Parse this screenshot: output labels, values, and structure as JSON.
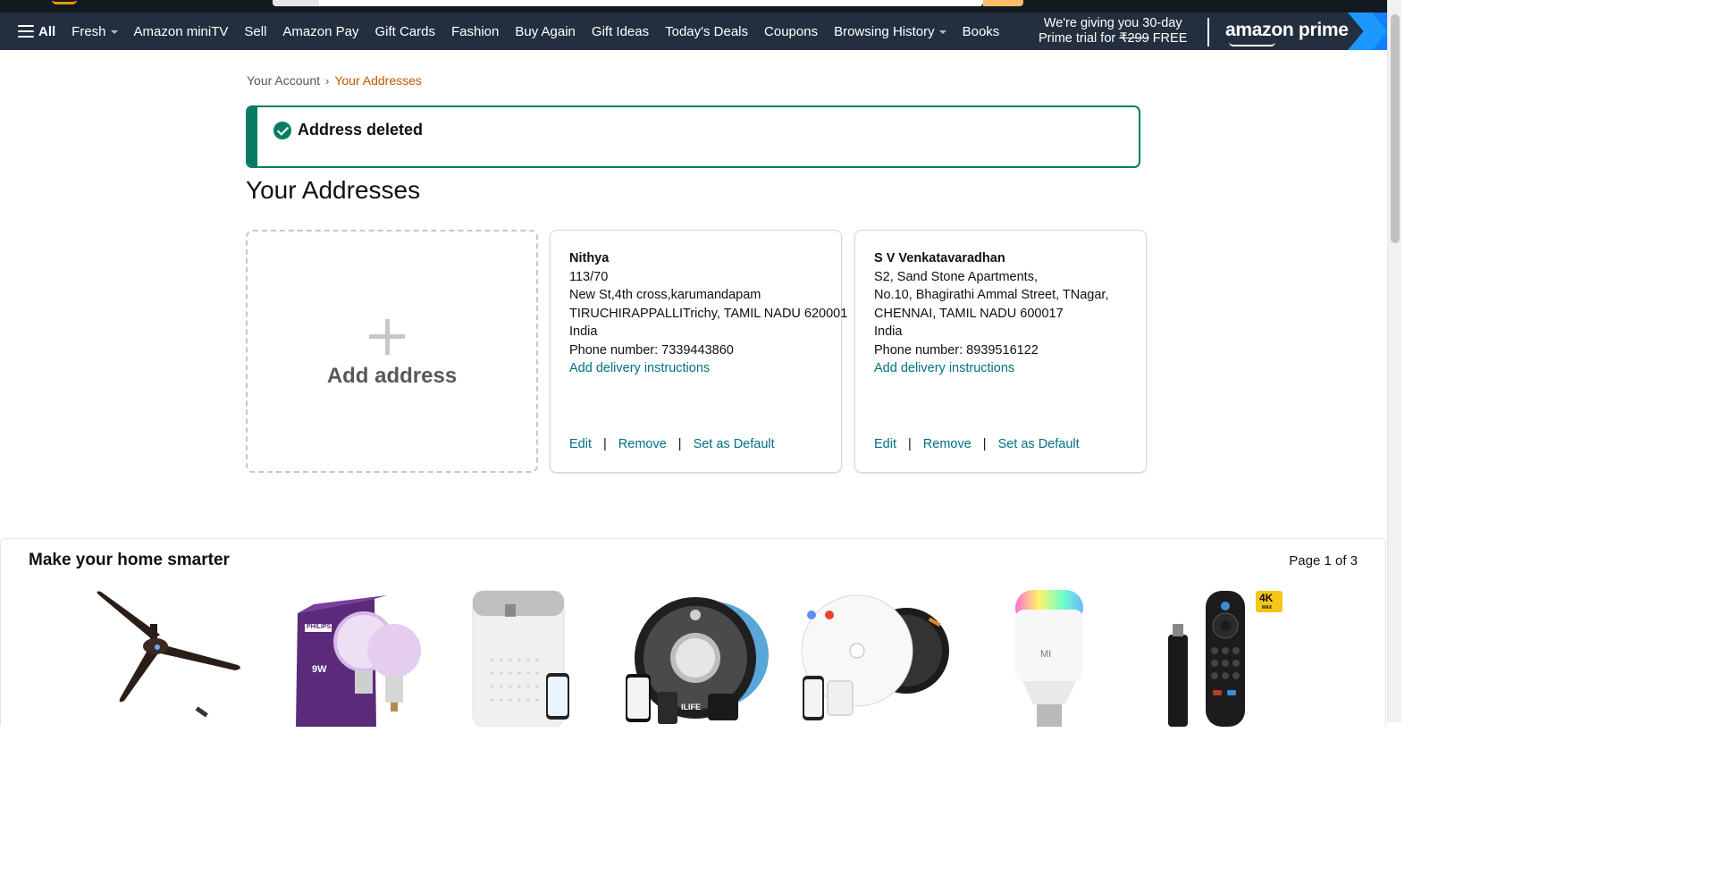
{
  "nav": {
    "all_label": "All",
    "items": [
      "Fresh",
      "Amazon miniTV",
      "Sell",
      "Amazon Pay",
      "Gift Cards",
      "Fashion",
      "Buy Again",
      "Gift Ideas",
      "Today's Deals",
      "Coupons",
      "Browsing History",
      "Books"
    ],
    "dropdown_items": [
      "Fresh",
      "Browsing History"
    ]
  },
  "prime_promo": {
    "line1": "We're giving you 30-day",
    "line2_prefix": "Prime trial for ",
    "price": "₹299",
    "line2_suffix": " FREE",
    "logo_text": "amazon prime"
  },
  "breadcrumb": {
    "parent": "Your Account",
    "separator": "›",
    "current": "Your Addresses"
  },
  "alert": {
    "message": "Address deleted",
    "color": "#067d62"
  },
  "page_title": "Your Addresses",
  "add_address": {
    "label": "Add address"
  },
  "addresses": [
    {
      "name": "Nithya",
      "lines": [
        "113/70",
        "New St,4th cross,karumandapam",
        "TIRUCHIRAPPALLITrichy, TAMIL NADU 620001",
        "India"
      ],
      "phone": "Phone number: 7339443860",
      "instructions_link": "Add delivery instructions",
      "actions": {
        "edit": "Edit",
        "remove": "Remove",
        "default": "Set as Default",
        "separator": "|"
      }
    },
    {
      "name": "S V Venkatavaradhan",
      "lines": [
        "S2, Sand Stone Apartments,",
        "No.10, Bhagirathi Ammal Street, TNagar,",
        "CHENNAI, TAMIL NADU 600017",
        "India"
      ],
      "phone": "Phone number: 8939516122",
      "instructions_link": "Add delivery instructions",
      "actions": {
        "edit": "Edit",
        "remove": "Remove",
        "default": "Set as Default",
        "separator": "|"
      }
    }
  ],
  "carousel": {
    "title": "Make your home smarter",
    "page": "Page 1 of 3",
    "products": [
      "ceiling-fan",
      "philips-smart-bulb",
      "air-purifier",
      "robot-vacuum-black",
      "robot-vacuum-white",
      "mi-smart-bulb",
      "fire-tv-stick-4k"
    ],
    "badge_4k": "4K",
    "badge_max": "MAX",
    "bulb_box_brand": "PHILIPS",
    "bulb_box_watt": "9W",
    "vacuum_brand": "ILIFE",
    "mi_logo": "MI"
  },
  "colors": {
    "nav_bg": "#232f3e",
    "top_bg": "#131921",
    "link": "#007185",
    "breadcrumb_current": "#c45500",
    "accent_orange": "#ff9900"
  }
}
